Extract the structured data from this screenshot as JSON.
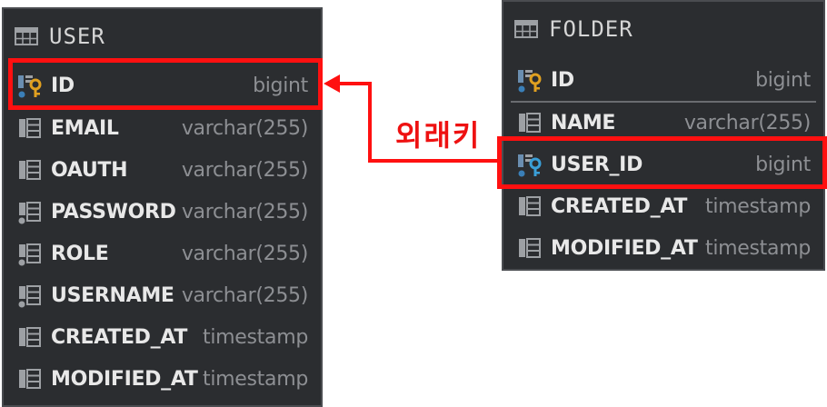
{
  "user_table": {
    "title": "USER",
    "columns": [
      {
        "name": "ID",
        "type": "bigint",
        "icon": "primary-key-icon"
      },
      {
        "name": "EMAIL",
        "type": "varchar(255)",
        "icon": "column-icon"
      },
      {
        "name": "OAUTH",
        "type": "varchar(255)",
        "icon": "column-icon"
      },
      {
        "name": "PASSWORD",
        "type": "varchar(255)",
        "icon": "column-required-icon"
      },
      {
        "name": "ROLE",
        "type": "varchar(255)",
        "icon": "column-required-icon"
      },
      {
        "name": "USERNAME",
        "type": "varchar(255)",
        "icon": "column-required-icon"
      },
      {
        "name": "CREATED_AT",
        "type": "timestamp",
        "icon": "column-icon"
      },
      {
        "name": "MODIFIED_AT",
        "type": "timestamp",
        "icon": "column-icon"
      }
    ]
  },
  "folder_table": {
    "title": "FOLDER",
    "columns": [
      {
        "name": "ID",
        "type": "bigint",
        "icon": "primary-key-icon"
      },
      {
        "name": "NAME",
        "type": "varchar(255)",
        "icon": "column-icon"
      },
      {
        "name": "USER_ID",
        "type": "bigint",
        "icon": "foreign-key-icon"
      },
      {
        "name": "CREATED_AT",
        "type": "timestamp",
        "icon": "column-icon"
      },
      {
        "name": "MODIFIED_AT",
        "type": "timestamp",
        "icon": "column-icon"
      }
    ]
  },
  "relation": {
    "label": "외래키",
    "color": "#ff1010"
  },
  "colors": {
    "panel": "#2b2d30",
    "name_text": "#e8e8e8",
    "type_text": "#8d8f93",
    "highlight": "#ff1010",
    "key_gold": "#e0a020",
    "key_blue": "#3a7fb8"
  }
}
